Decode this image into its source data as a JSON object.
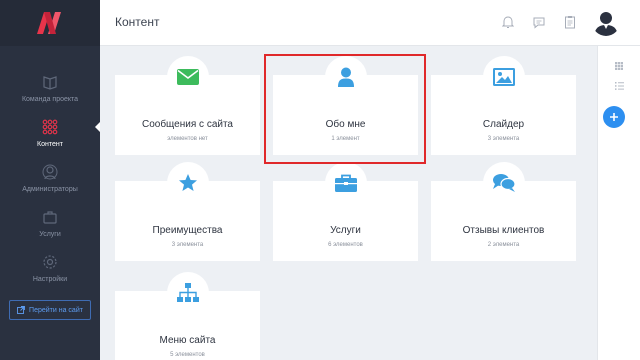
{
  "sidebar": {
    "items": [
      {
        "label": "Команда проекта",
        "icon": "book-icon",
        "active": false
      },
      {
        "label": "Контент",
        "icon": "grid-icon",
        "active": true
      },
      {
        "label": "Администраторы",
        "icon": "user-shield-icon",
        "active": false
      },
      {
        "label": "Услуги",
        "icon": "briefcase-icon",
        "active": false
      },
      {
        "label": "Настройки",
        "icon": "gear-icon",
        "active": false
      }
    ],
    "site_button": "Перейти на сайт"
  },
  "header": {
    "title": "Контент",
    "icons": [
      "bell-icon",
      "chat-icon",
      "clipboard-icon"
    ]
  },
  "cards": [
    {
      "title": "Сообщения с сайта",
      "subtitle": "элементов нет",
      "icon": "envelope-icon",
      "color": "#3dbb5c"
    },
    {
      "title": "Обо мне",
      "subtitle": "1 элемент",
      "icon": "person-icon",
      "color": "#3c9fe0"
    },
    {
      "title": "Слайдер",
      "subtitle": "3 элемента",
      "icon": "image-icon",
      "color": "#3c9fe0"
    },
    {
      "title": "Преимущества",
      "subtitle": "3 элемента",
      "icon": "star-icon",
      "color": "#3c9fe0"
    },
    {
      "title": "Услуги",
      "subtitle": "6 элементов",
      "icon": "briefcase-icon",
      "color": "#3c9fe0"
    },
    {
      "title": "Отзывы клиентов",
      "subtitle": "2 элемента",
      "icon": "chat-bubbles-icon",
      "color": "#3c9fe0"
    },
    {
      "title": "Меню сайта",
      "subtitle": "5 элементов",
      "icon": "sitemap-icon",
      "color": "#3c9fe0"
    }
  ],
  "colors": {
    "sidebar_bg": "#2a3140",
    "accent_blue": "#2d8ff0",
    "logo_red": "#e8344a",
    "highlight_red": "#e0282a"
  }
}
